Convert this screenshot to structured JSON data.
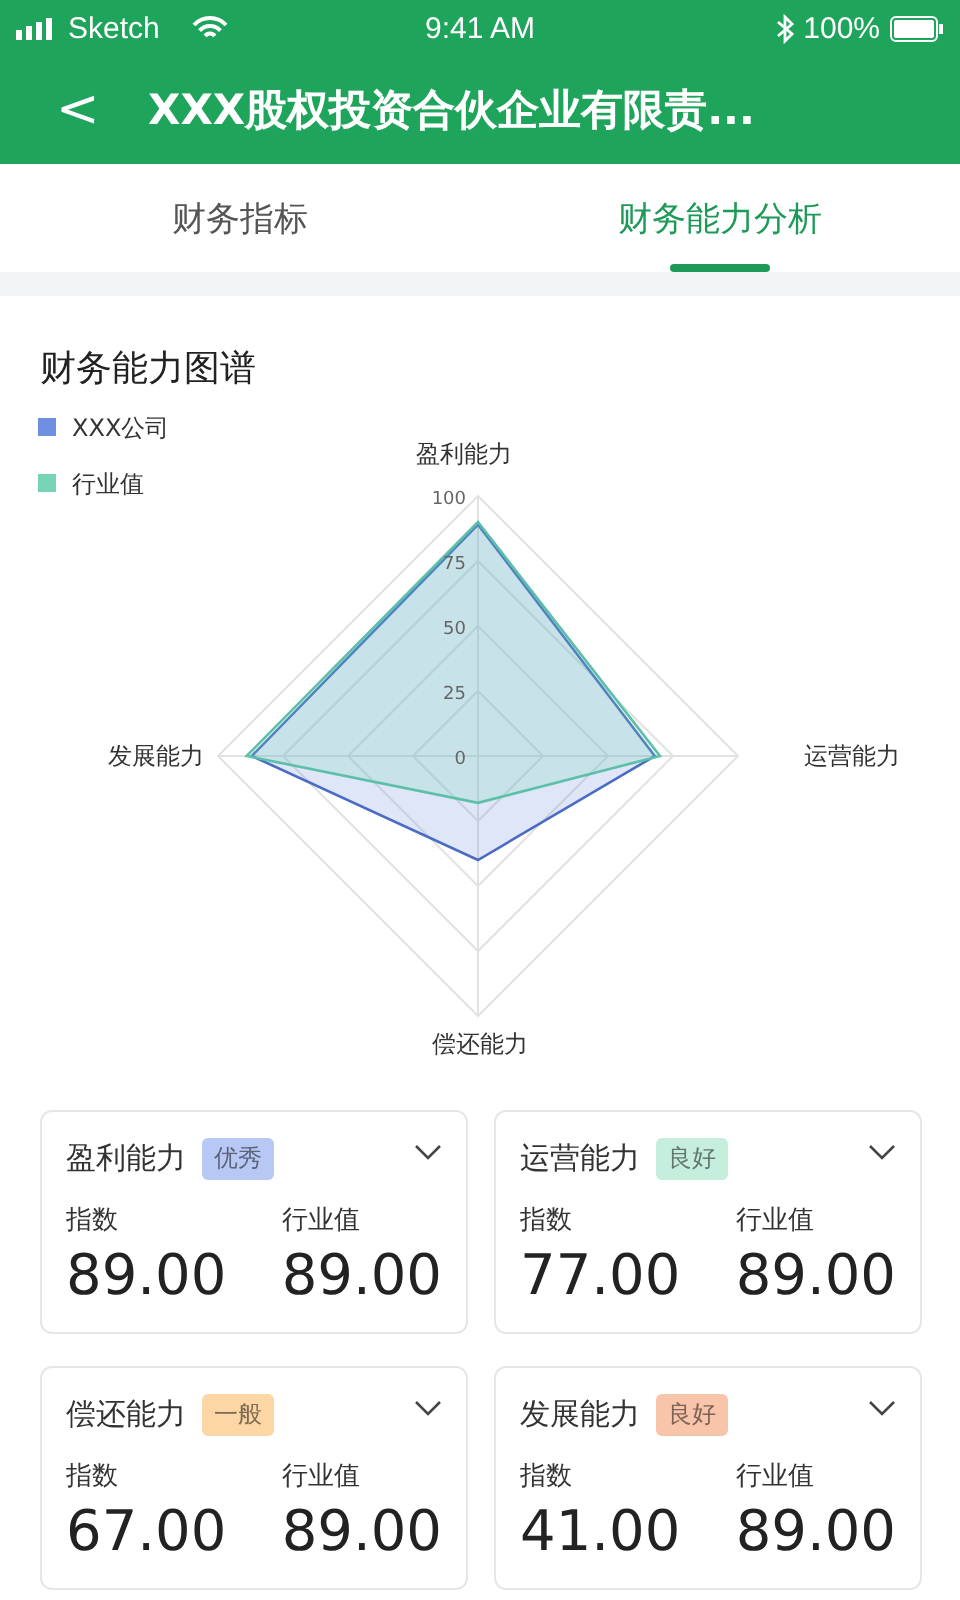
{
  "status_bar": {
    "carrier": "Sketch",
    "time": "9:41 AM",
    "battery": "100%"
  },
  "nav": {
    "back": "<",
    "title": "XXX股权投资合伙企业有限责..."
  },
  "tabs": [
    {
      "label": "财务指标",
      "selected": false
    },
    {
      "label": "财务能力分析",
      "selected": true
    }
  ],
  "section_title": "财务能力图谱",
  "chart_data": {
    "type": "radar",
    "categories": [
      "盈利能力",
      "运营能力",
      "偿还能力",
      "发展能力"
    ],
    "yticks": [
      0,
      25,
      50,
      75,
      100
    ],
    "ylim": [
      0,
      100
    ],
    "legend": "top-left",
    "series": [
      {
        "name": "XXX公司",
        "color": "#6f8fe0",
        "values": [
          89,
          68,
          40,
          87
        ]
      },
      {
        "name": "行业值",
        "color": "#74d4b4",
        "values": [
          90,
          70,
          18,
          89
        ]
      }
    ]
  },
  "cards": [
    {
      "title": "盈利能力",
      "badge": {
        "text": "优秀",
        "color": "#b8c8f5"
      },
      "expanded": false,
      "index_label": "指数",
      "index_value": "89.00",
      "industry_label": "行业值",
      "industry_value": "89.00"
    },
    {
      "title": "运营能力",
      "badge": {
        "text": "良好",
        "color": "#c6eedd"
      },
      "expanded": false,
      "index_label": "指数",
      "index_value": "77.00",
      "industry_label": "行业值",
      "industry_value": "89.00"
    },
    {
      "title": "偿还能力",
      "badge": {
        "text": "一般",
        "color": "#fdd6a6"
      },
      "expanded": false,
      "index_label": "指数",
      "index_value": "67.00",
      "industry_label": "行业值",
      "industry_value": "89.00"
    },
    {
      "title": "发展能力",
      "badge": {
        "text": "良好",
        "color": "#f8c4aa"
      },
      "expanded": false,
      "index_label": "指数",
      "index_value": "41.00",
      "industry_label": "行业值",
      "industry_value": "89.00"
    }
  ]
}
